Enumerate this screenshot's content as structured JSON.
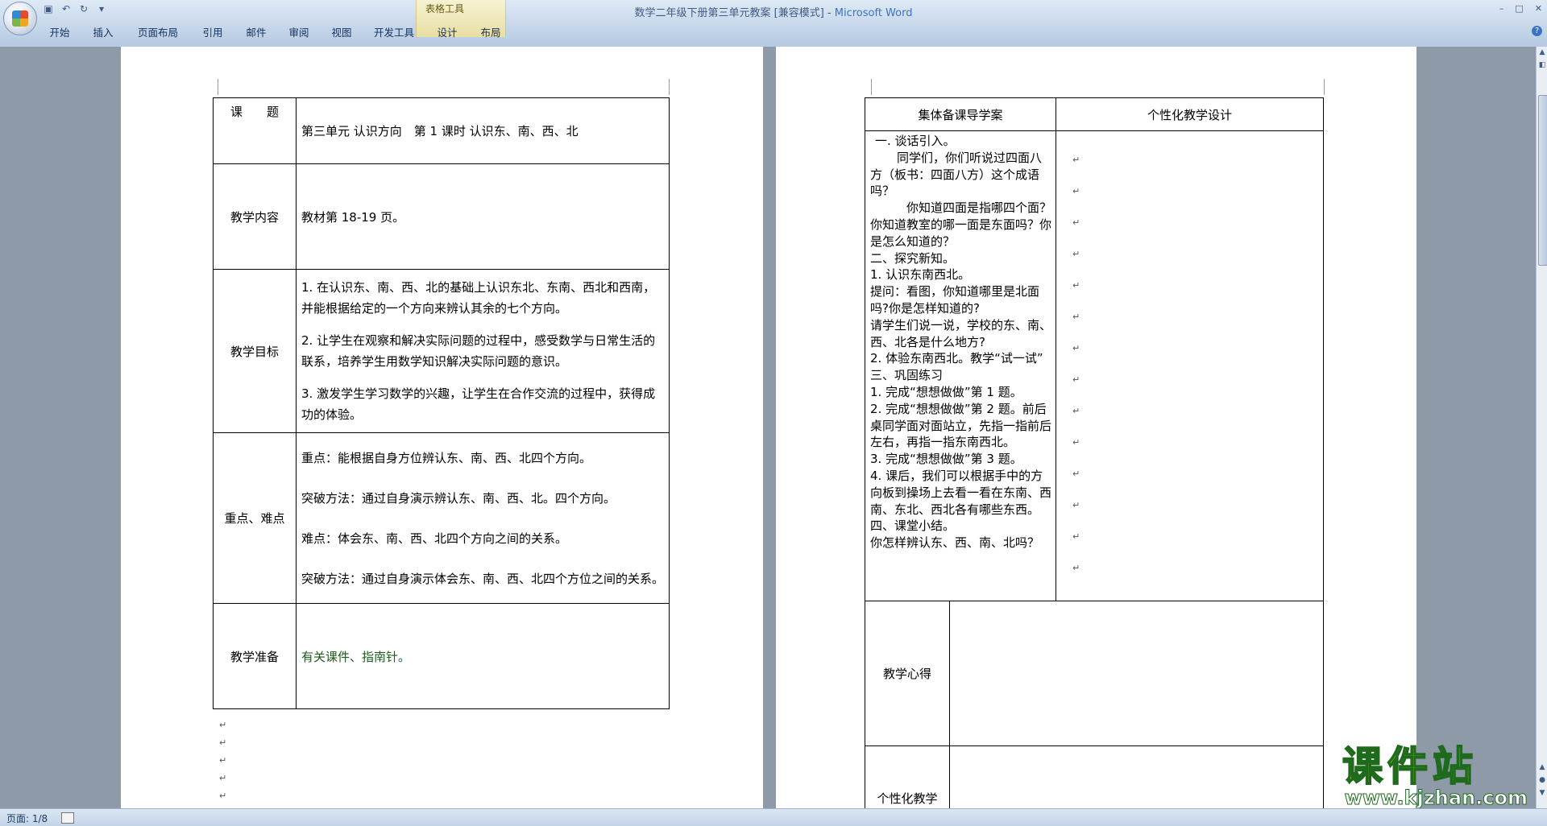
{
  "app": {
    "title_doc": "数学二年级下册第三单元教案 [兼容模式]",
    "title_sep": " - ",
    "title_app": "Microsoft Word",
    "context_tab_group": "表格工具",
    "window_buttons": [
      "–",
      "□",
      "✕"
    ],
    "help": "?"
  },
  "ribbon": {
    "tabs": [
      "开始",
      "插入",
      "页面布局",
      "引用",
      "邮件",
      "审阅",
      "视图",
      "开发工具",
      "设计",
      "布局"
    ]
  },
  "page1": {
    "rows": [
      {
        "label": "课　　题",
        "content": [
          "第三单元 认识方向　第 1 课时 认识东、南、西、北"
        ]
      },
      {
        "label": "教学内容",
        "content": [
          "教材第 18-19 页。"
        ]
      },
      {
        "label": "教学目标",
        "content": [
          "1. 在认识东、南、西、北的基础上认识东北、东南、西北和西南，并能根据给定的一个方向来辨认其余的七个方向。",
          "2. 让学生在观察和解决实际问题的过程中，感受数学与日常生活的联系，培养学生用数学知识解决实际问题的意识。",
          "3. 激发学生学习数学的兴趣，让学生在合作交流的过程中，获得成功的体验。"
        ]
      },
      {
        "label": "重点、难点",
        "content": [
          "重点：能根据自身方位辨认东、南、西、北四个方向。",
          "突破方法：通过自身演示辨认东、南、西、北。四个方向。",
          "难点：体会东、南、西、北四个方向之间的关系。",
          "突破方法：通过自身演示体会东、南、西、北四个方位之间的关系。"
        ]
      },
      {
        "label": "教学准备",
        "content": [
          "有关课件、指南针。"
        ]
      }
    ]
  },
  "page2": {
    "header_left": "集体备课导学案",
    "header_right": "个性化教学设计",
    "lesson_lines": [
      "一. 谈话引入。",
      "　同学们，你们听说过四面八方（板书：四面八方）这个成语吗？",
      "　你知道四面是指哪四个面？你知道教室的哪一面是东面吗？你是怎么知道的？",
      "二、探究新知。",
      "1. 认识东南西北。",
      "提问：看图，你知道哪里是北面吗?你是怎样知道的?",
      "请学生们说一说，学校的东、南、西、北各是什么地方?",
      "2. 体验东南西北。教学“试一试”",
      "三、巩固练习",
      "1. 完成“想想做做”第 1 题。",
      "2. 完成“想想做做”第 2 题。前后桌同学面对面站立，先指一指前后左右，再指一指东南西北。",
      "3. 完成“想想做做”第 3 题。",
      "4. 课后，我们可以根据手中的方向板到操场上去看一看在东南、西南、东北、西北各有哪些东西。",
      "四、课堂小结。",
      "你怎样辨认东、西、南、北吗？"
    ],
    "reflect_label": "教学心得",
    "personal_label": "个性化教学"
  },
  "status": {
    "page": "页面: 1/8"
  },
  "watermark": {
    "name": "课件站",
    "url": "www.kjzhan.com"
  }
}
